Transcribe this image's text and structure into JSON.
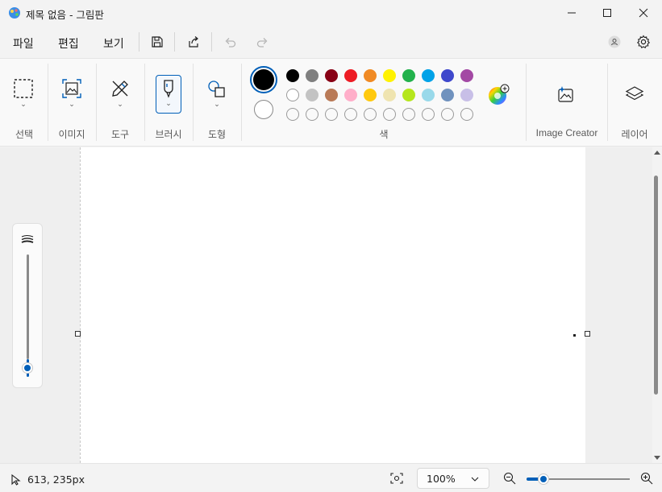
{
  "window": {
    "title": "제목 없음 - 그림판"
  },
  "menu": {
    "file": "파일",
    "edit": "편집",
    "view": "보기"
  },
  "ribbon": {
    "groups": {
      "selection": "선택",
      "image": "이미지",
      "tools": "도구",
      "brushes": "브러시",
      "shapes": "도형",
      "colors": "색",
      "image_creator": "Image Creator",
      "layers": "레이어"
    },
    "palette_row1": [
      "#000000",
      "#7f7f7f",
      "#880015",
      "#ed1c24",
      "#f08a24",
      "#fff200",
      "#22b14c",
      "#00a2e8",
      "#3f48cc",
      "#a349a4"
    ],
    "palette_row2": [
      "#ffffff",
      "#c3c3c3",
      "#b97a57",
      "#ffaec9",
      "#ffc90e",
      "#efe4b0",
      "#b5e61d",
      "#99d9ea",
      "#7092be",
      "#c8bfe7"
    ],
    "primary_color": "#000000",
    "secondary_color": "#ffffff",
    "accent": "#005fb8"
  },
  "status": {
    "cursor_position": "613, 235px",
    "zoom_value": "100%"
  }
}
